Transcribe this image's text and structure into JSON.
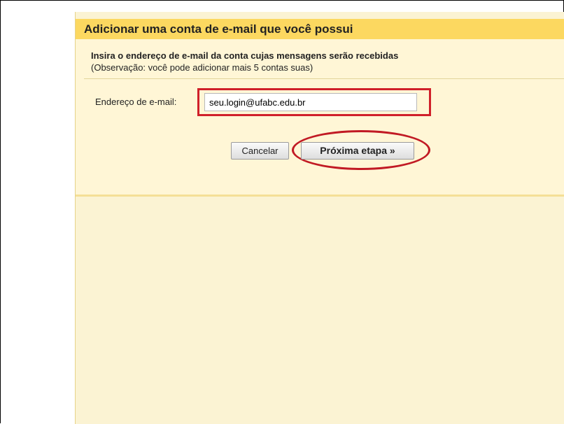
{
  "dialog": {
    "title": "Adicionar uma conta de e-mail que você possui",
    "instruction": "Insira o endereço de e-mail da conta cujas mensagens serão recebidas",
    "note": "(Observação: você pode adicionar mais 5 contas suas)",
    "email_label": "Endereço de e-mail:",
    "email_value": "seu.login@ufabc.edu.br",
    "cancel_label": "Cancelar",
    "next_label": "Próxima etapa »"
  },
  "colors": {
    "title_bar": "#fcd860",
    "panel_background": "#fff6d6",
    "annotation_red": "#d0202a"
  }
}
